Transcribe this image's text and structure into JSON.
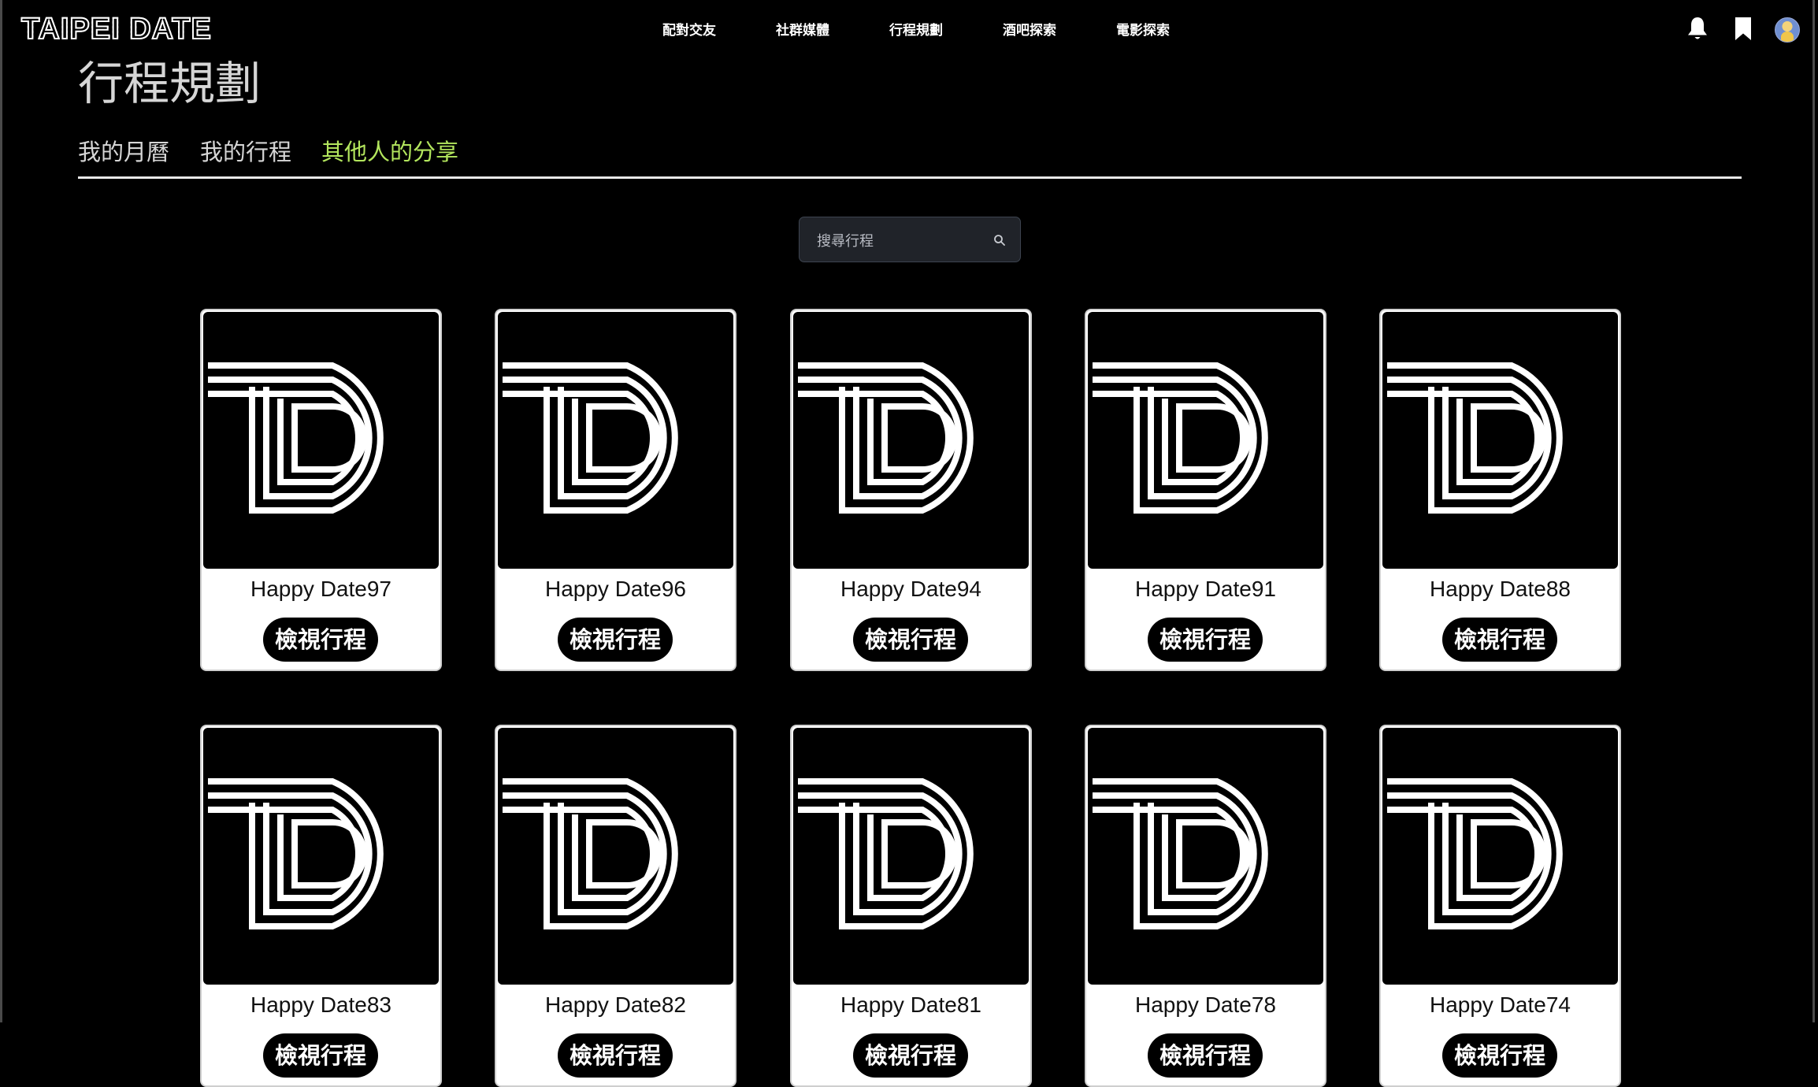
{
  "app": {
    "logo_text": "TAIPEI DATE"
  },
  "nav": {
    "items": [
      {
        "label": "配對交友"
      },
      {
        "label": "社群媒體"
      },
      {
        "label": "行程規劃"
      },
      {
        "label": "酒吧探索"
      },
      {
        "label": "電影探索"
      }
    ],
    "icons": [
      "bell-icon",
      "bookmark-icon",
      "avatar"
    ]
  },
  "page": {
    "title": "行程規劃",
    "tabs": [
      {
        "label": "我的月曆",
        "active": false
      },
      {
        "label": "我的行程",
        "active": false
      },
      {
        "label": "其他人的分享",
        "active": true
      }
    ],
    "active_tab_color": "#b3e65d"
  },
  "search": {
    "placeholder": "搜尋行程",
    "value": ""
  },
  "cards": [
    {
      "title": "Happy Date97",
      "button": "檢視行程"
    },
    {
      "title": "Happy Date96",
      "button": "檢視行程"
    },
    {
      "title": "Happy Date94",
      "button": "檢視行程"
    },
    {
      "title": "Happy Date91",
      "button": "檢視行程"
    },
    {
      "title": "Happy Date88",
      "button": "檢視行程"
    },
    {
      "title": "Happy Date83",
      "button": "檢視行程"
    },
    {
      "title": "Happy Date82",
      "button": "檢視行程"
    },
    {
      "title": "Happy Date81",
      "button": "檢視行程"
    },
    {
      "title": "Happy Date78",
      "button": "檢視行程"
    },
    {
      "title": "Happy Date74",
      "button": "檢視行程"
    }
  ]
}
